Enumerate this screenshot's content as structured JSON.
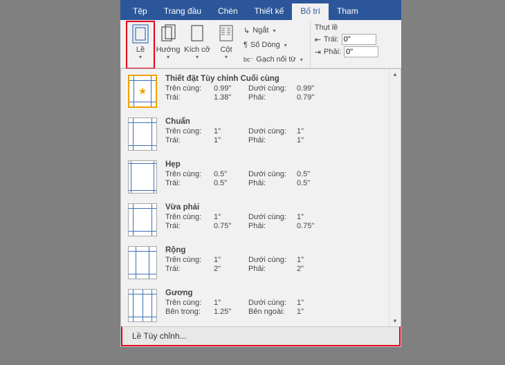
{
  "tabs": {
    "file": "Tệp",
    "home": "Trang đầu",
    "insert": "Chèn",
    "design": "Thiết kế",
    "layout": "Bố trí",
    "references": "Tham"
  },
  "ribbon": {
    "margins": "Lề",
    "orientation": "Hướng",
    "size": "Kích cỡ",
    "columns": "Cột",
    "breaks": "Ngắt",
    "lineNumbers": "Số Dòng",
    "hyphenation": "Gạch nối từ",
    "indent": {
      "header": "Thụt lề",
      "left": "Trái:",
      "right": "Phải:",
      "leftVal": "0\"",
      "rightVal": "0\""
    }
  },
  "dropdown": {
    "items": [
      {
        "title": "Thiết đặt Tùy chỉnh Cuối cùng",
        "topLabel": "Trên cùng:",
        "topVal": "0.99\"",
        "bottomLabel": "Dưới cùng:",
        "bottomVal": "0.99\"",
        "leftLabel": "Trái:",
        "leftVal": "1.38\"",
        "rightLabel": "Phải:",
        "rightVal": "0.79\""
      },
      {
        "title": "Chuẩn",
        "topLabel": "Trên cùng:",
        "topVal": "1\"",
        "bottomLabel": "Dưới cùng:",
        "bottomVal": "1\"",
        "leftLabel": "Trái:",
        "leftVal": "1\"",
        "rightLabel": "Phải:",
        "rightVal": "1\""
      },
      {
        "title": "Hẹp",
        "topLabel": "Trên cùng:",
        "topVal": "0.5\"",
        "bottomLabel": "Dưới cùng:",
        "bottomVal": "0.5\"",
        "leftLabel": "Trái:",
        "leftVal": "0.5\"",
        "rightLabel": "Phải:",
        "rightVal": "0.5\""
      },
      {
        "title": "Vừa phải",
        "topLabel": "Trên cùng:",
        "topVal": "1\"",
        "bottomLabel": "Dưới cùng:",
        "bottomVal": "1\"",
        "leftLabel": "Trái:",
        "leftVal": "0.75\"",
        "rightLabel": "Phải:",
        "rightVal": "0.75\""
      },
      {
        "title": "Rộng",
        "topLabel": "Trên cùng:",
        "topVal": "1\"",
        "bottomLabel": "Dưới cùng:",
        "bottomVal": "1\"",
        "leftLabel": "Trái:",
        "leftVal": "2\"",
        "rightLabel": "Phải:",
        "rightVal": "2\""
      },
      {
        "title": "Gương",
        "topLabel": "Trên cùng:",
        "topVal": "1\"",
        "bottomLabel": "Dưới cùng:",
        "bottomVal": "1\"",
        "leftLabel": "Bên trong:",
        "leftVal": "1.25\"",
        "rightLabel": "Bên ngoài:",
        "rightVal": "1\""
      }
    ],
    "custom": "Lề Tùy chỉnh..."
  }
}
